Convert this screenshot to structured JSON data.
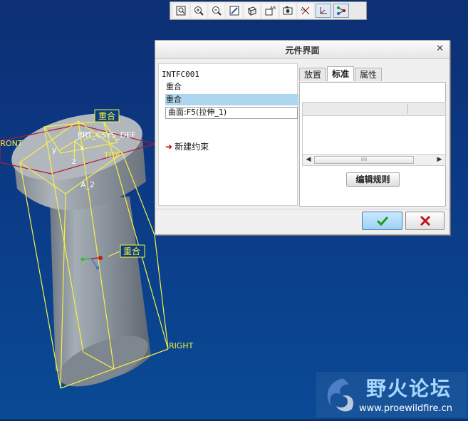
{
  "toolbar": {
    "buttons": [
      {
        "icon": "zoom-fit-icon"
      },
      {
        "icon": "zoom-in-icon"
      },
      {
        "icon": "zoom-out-icon"
      },
      {
        "icon": "repaint-icon"
      },
      {
        "icon": "view-orientation-icon"
      },
      {
        "icon": "saved-views-icon"
      },
      {
        "icon": "layers-icon"
      },
      {
        "icon": "datum-axis-icon"
      },
      {
        "icon": "datum-csys-icon"
      },
      {
        "icon": "datum-point-icon"
      }
    ]
  },
  "viewport": {
    "labels": {
      "front": "FRONT",
      "csys": "PRT_CSYS_DEF",
      "top": "TOP",
      "axis": "A_2",
      "right": "RIGHT",
      "y_axis": "y",
      "x_axis": "x",
      "z_axis": "z"
    },
    "tags": {
      "tag1": "重合",
      "tag2": "重合"
    }
  },
  "dialog": {
    "title": "元件界面",
    "tree": {
      "root": "INTFC001",
      "items": [
        "重合",
        "重合",
        "曲面:F5(拉伸_1)"
      ],
      "new_constraint": "新建约束"
    },
    "tabs": [
      {
        "label": "放置",
        "active": false
      },
      {
        "label": "标准",
        "active": true
      },
      {
        "label": "属性",
        "active": false
      }
    ],
    "edit_rule_label": "编辑规则",
    "scroll_thumb": "IIII"
  },
  "watermark": {
    "title": "野火论坛",
    "url": "www.proewildfire.cn"
  },
  "colors": {
    "background_top": "#0d2f73",
    "model_yellow": "#f6f240",
    "datum_red": "#b21a2e",
    "selection_blue": "#add6ef",
    "ok_green": "#1c9a1c",
    "cancel_red": "#c0141c"
  }
}
